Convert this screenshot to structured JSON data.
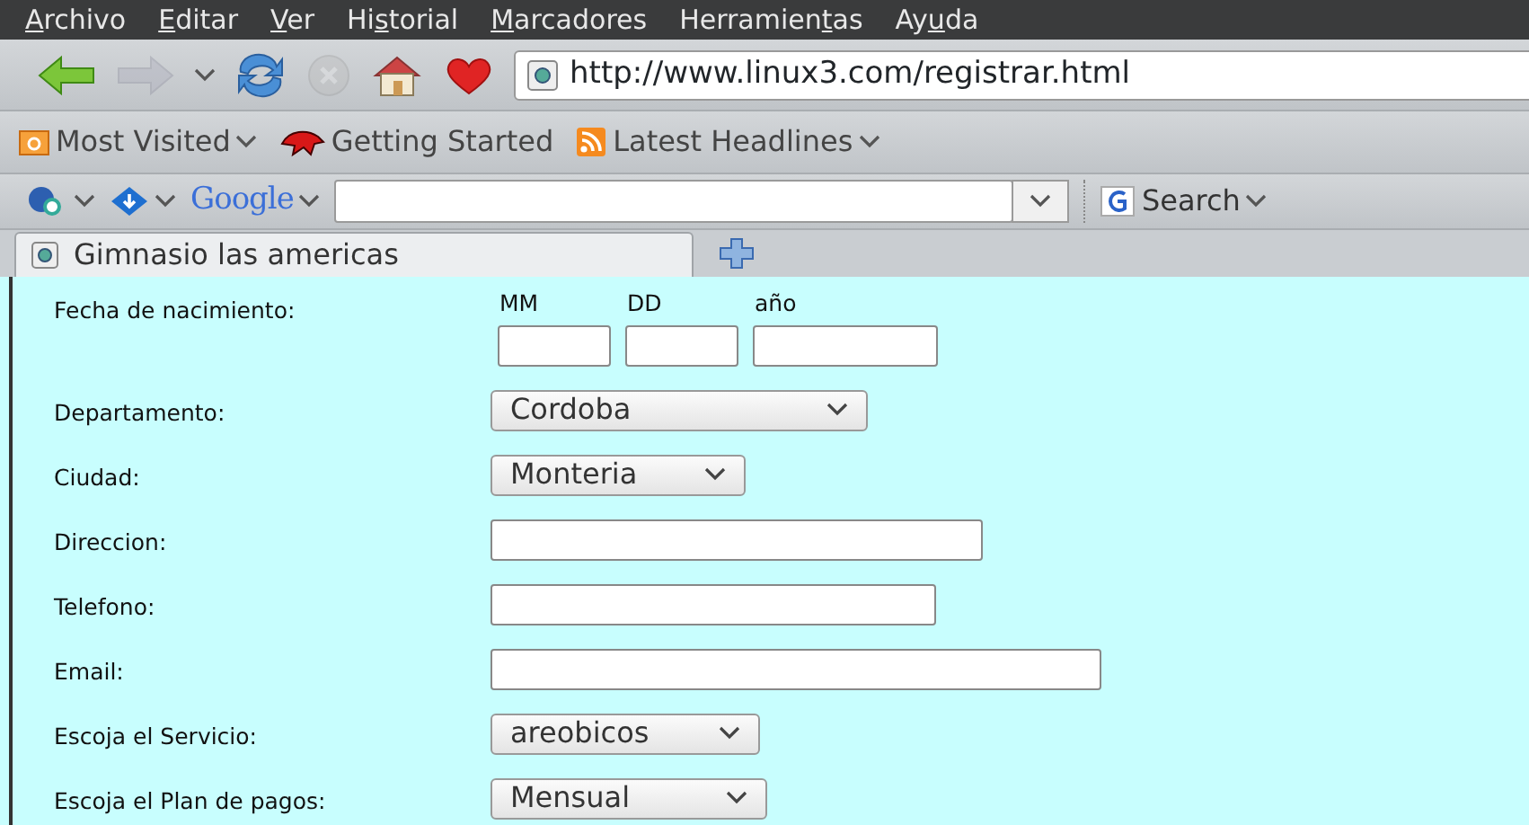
{
  "menu_bar": [
    {
      "key": "A",
      "post": "rchivo"
    },
    {
      "key": "E",
      "post": "ditar"
    },
    {
      "key": "V",
      "post": "er"
    },
    {
      "pre": "Hi",
      "key": "s",
      "post": "torial"
    },
    {
      "key": "M",
      "post": "arcadores"
    },
    {
      "pre": "Herramien",
      "key": "t",
      "post": "as"
    },
    {
      "pre": "Ay",
      "key": "u",
      "post": "da"
    }
  ],
  "navigation": {
    "back_disabled": false,
    "forward_disabled": true,
    "stop_disabled": true,
    "address": "http://www.linux3.com/registrar.html"
  },
  "bookmarks": [
    {
      "label": "Most Visited",
      "kind": "folder",
      "dropdown": true
    },
    {
      "label": "Getting Started",
      "kind": "start",
      "dropdown": false
    },
    {
      "label": "Latest Headlines",
      "kind": "feed",
      "dropdown": true
    }
  ],
  "search_bar": {
    "engine": "Google",
    "button": "Search"
  },
  "tabs": [
    {
      "label": "Gimnasio las americas",
      "selected": true
    }
  ],
  "form": {
    "birth_date": {
      "label": "Fecha de nacimiento:",
      "parts": [
        {
          "label": "MM"
        },
        {
          "label": "DD"
        },
        {
          "label": "año"
        }
      ]
    },
    "fields": [
      {
        "label": "Departamento:",
        "kind": "select",
        "value": "Cordoba"
      },
      {
        "label": "Ciudad:",
        "kind": "select",
        "value": "Monteria"
      },
      {
        "label": "Direccion:",
        "kind": "text"
      },
      {
        "label": "Telefono:",
        "kind": "text"
      },
      {
        "label": "Email:",
        "kind": "text"
      },
      {
        "label": "Escoja el Servicio:",
        "kind": "select",
        "value": "areobicos"
      },
      {
        "label": "Escoja el Plan de pagos:",
        "kind": "select",
        "value": "Mensual"
      }
    ]
  }
}
